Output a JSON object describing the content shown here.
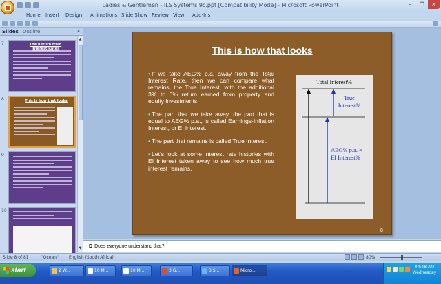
{
  "window": {
    "title": "Ladies & Gentlemen - ILS Systems 9c.ppt [Compatibility Mode] - Microsoft PowerPoint",
    "controls": {
      "minimize": "–",
      "maximize": "❐",
      "close": "✕"
    }
  },
  "ribbon": {
    "tabs": [
      "Home",
      "Insert",
      "Design",
      "Animations",
      "Slide Show",
      "Review",
      "View",
      "Add-Ins"
    ]
  },
  "pane": {
    "tabs": {
      "slides": "Slides",
      "outline": "Outline"
    },
    "close": "×",
    "thumbnails": [
      {
        "number": "7",
        "title": "The Return from Interest Rates"
      },
      {
        "number": "8",
        "title": "This is how that looks",
        "selected": true
      },
      {
        "number": "9",
        "title": ""
      },
      {
        "number": "10",
        "title": ""
      }
    ]
  },
  "slide": {
    "title": "This is how that looks",
    "paragraphs": [
      {
        "parts": [
          {
            "text": "If we take AEG% p.a. away from the Total Interest Rate, then we can compare what remains, the True Interest, with the additional 3% to 6% return earned from property and equity investments."
          }
        ]
      },
      {
        "parts": [
          {
            "text": "The part that we take away, the part that is equal to AEG% p.a., is called "
          },
          {
            "text": "Earnings-Inflation Interest",
            "u": true
          },
          {
            "text": ", or "
          },
          {
            "text": "EI interest",
            "u": true
          },
          {
            "text": "."
          }
        ]
      },
      {
        "parts": [
          {
            "text": "The part that remains is called "
          },
          {
            "text": "True Interest",
            "u": true
          },
          {
            "text": "."
          }
        ]
      },
      {
        "parts": [
          {
            "text": "Let’s look at some interest rate histories with "
          },
          {
            "text": "EI Interest",
            "u": true
          },
          {
            "text": " taken away to see how much true interest remains."
          }
        ]
      }
    ],
    "figure": {
      "top_label": "Total Interest%",
      "true_label_1": "True",
      "true_label_2": "Interest%",
      "aeg_label_1": "AEG% p.a. =",
      "aeg_label_2": "EI Interest%",
      "blue": "#1f2fb8"
    },
    "number": "8",
    "background": "#8c5d28"
  },
  "notes": {
    "bold": "D",
    "text": "Does everyone understand that?"
  },
  "status": {
    "slide": "Slide 8 of 81",
    "theme": "\"Ocean\"",
    "language": "English (South Africa)",
    "zoom": "80%"
  },
  "taskbar": {
    "start": "start",
    "tasks": [
      "2 W...",
      "10 M...",
      "10 M...",
      "3 G...",
      "3 S...",
      "Micro..."
    ],
    "time": "04:48 AM",
    "day": "Wednesday"
  }
}
